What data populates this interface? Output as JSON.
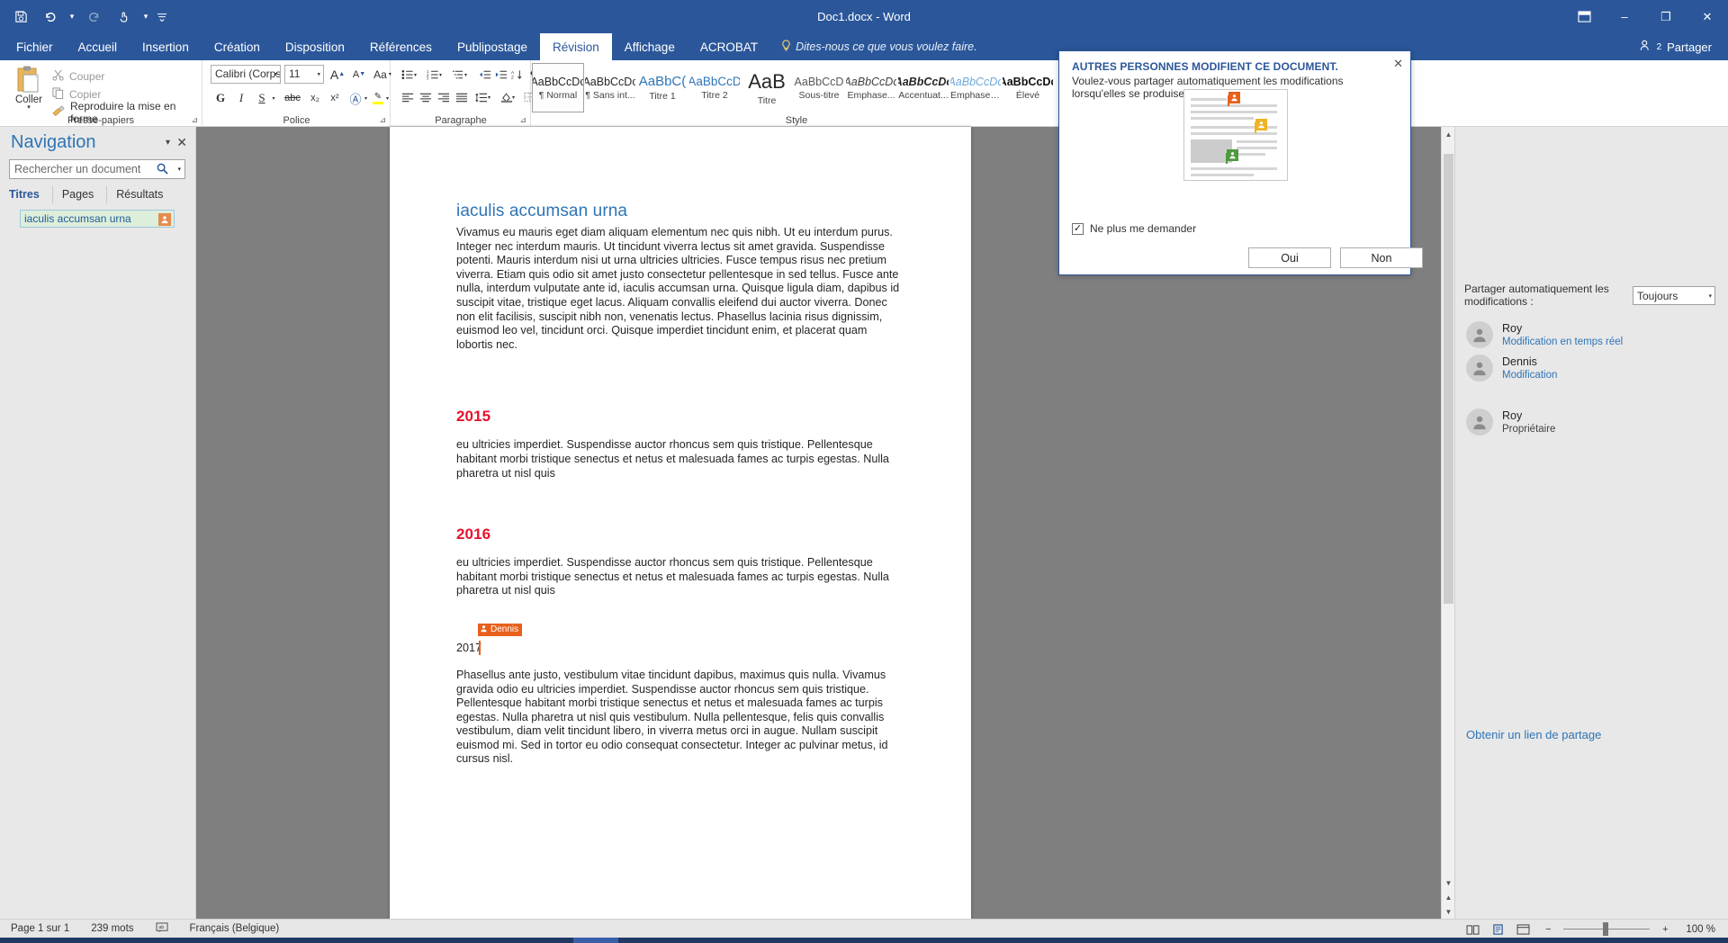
{
  "titlebar": {
    "document_title": "Doc1.docx - Word",
    "qat": [
      {
        "name": "save-icon",
        "glyph": "💾"
      },
      {
        "name": "undo-icon",
        "glyph": "↶"
      },
      {
        "name": "redo-icon",
        "glyph": "↻"
      },
      {
        "name": "touch-mode-icon",
        "glyph": "☝"
      },
      {
        "name": "customize-qat-icon",
        "glyph": "≡"
      }
    ],
    "ribbon_display_options": "⬜",
    "minimize": "–",
    "restore": "❐",
    "close": "✕"
  },
  "tabs": [
    {
      "label": "Fichier",
      "active": false
    },
    {
      "label": "Accueil",
      "active": false
    },
    {
      "label": "Insertion",
      "active": false
    },
    {
      "label": "Création",
      "active": false
    },
    {
      "label": "Disposition",
      "active": false
    },
    {
      "label": "Références",
      "active": false
    },
    {
      "label": "Publipostage",
      "active": false
    },
    {
      "label": "Révision",
      "active": true
    },
    {
      "label": "Affichage",
      "active": false
    },
    {
      "label": "ACROBAT",
      "active": false
    }
  ],
  "tellme": {
    "icon": "lightbulb-icon",
    "text": "Dites-nous ce que vous voulez faire."
  },
  "share": {
    "icon": "person-share-icon",
    "count": "2",
    "label": "Partager"
  },
  "ribbon": {
    "clipboard": {
      "group_label": "Presse-papiers",
      "paste_label": "Coller",
      "items": [
        {
          "label": "Couper",
          "icon": "scissors-icon",
          "enabled": false
        },
        {
          "label": "Copier",
          "icon": "copy-icon",
          "enabled": false
        },
        {
          "label": "Reproduire la mise en forme",
          "icon": "format-painter-icon",
          "enabled": true
        }
      ]
    },
    "font": {
      "group_label": "Police",
      "font_name": "Calibri (Corps",
      "font_size": "11",
      "buttons_row1": [
        {
          "name": "grow-font-icon",
          "glyph": "A"
        },
        {
          "name": "shrink-font-icon",
          "glyph": "A"
        },
        {
          "name": "change-case-icon",
          "glyph": "Aa"
        },
        {
          "name": "clear-formatting-icon",
          "glyph": "⬚"
        }
      ],
      "buttons_row2": [
        {
          "name": "bold-icon",
          "glyph": "G"
        },
        {
          "name": "italic-icon",
          "glyph": "I"
        },
        {
          "name": "underline-icon",
          "glyph": "S"
        },
        {
          "name": "strikethrough-icon",
          "glyph": "abc"
        },
        {
          "name": "subscript-icon",
          "glyph": "x₂"
        },
        {
          "name": "superscript-icon",
          "glyph": "x²"
        },
        {
          "name": "text-effects-icon",
          "glyph": "A"
        },
        {
          "name": "text-highlight-icon",
          "glyph": "✎"
        },
        {
          "name": "font-color-icon",
          "glyph": "A"
        }
      ]
    },
    "paragraph": {
      "group_label": "Paragraphe",
      "buttons_row1": [
        {
          "name": "bullets-icon",
          "glyph": "☰"
        },
        {
          "name": "numbering-icon",
          "glyph": "☰"
        },
        {
          "name": "multilevel-list-icon",
          "glyph": "☰"
        },
        {
          "name": "decrease-indent-icon",
          "glyph": "⇤"
        },
        {
          "name": "increase-indent-icon",
          "glyph": "⇥"
        },
        {
          "name": "sort-icon",
          "glyph": "↓"
        },
        {
          "name": "show-marks-icon",
          "glyph": "¶"
        }
      ],
      "buttons_row2": [
        {
          "name": "align-left-icon",
          "glyph": "≡"
        },
        {
          "name": "align-center-icon",
          "glyph": "≡"
        },
        {
          "name": "align-right-icon",
          "glyph": "≡"
        },
        {
          "name": "justify-icon",
          "glyph": "≡"
        },
        {
          "name": "line-spacing-icon",
          "glyph": "↕"
        },
        {
          "name": "shading-icon",
          "glyph": "▣"
        },
        {
          "name": "borders-icon",
          "glyph": "▦"
        }
      ]
    },
    "style": {
      "group_label": "Style",
      "items": [
        {
          "preview": "AaBbCcDc",
          "name": "¶ Normal",
          "selected": true,
          "color": "#262626",
          "italic": false,
          "bold": false,
          "size": 12.5
        },
        {
          "preview": "AaBbCcDc",
          "name": "¶ Sans int...",
          "selected": false,
          "color": "#262626",
          "italic": false,
          "bold": false,
          "size": 12.5
        },
        {
          "preview": "AaBbC(",
          "name": "Titre 1",
          "selected": false,
          "color": "#2e75b6",
          "italic": false,
          "bold": false,
          "size": 15
        },
        {
          "preview": "AaBbCcD",
          "name": "Titre 2",
          "selected": false,
          "color": "#2e75b6",
          "italic": false,
          "bold": false,
          "size": 13.5
        },
        {
          "preview": "AaB",
          "name": "Titre",
          "selected": false,
          "color": "#262626",
          "italic": false,
          "bold": false,
          "size": 22
        },
        {
          "preview": "AaBbCcD",
          "name": "Sous-titre",
          "selected": false,
          "color": "#595959",
          "italic": false,
          "bold": false,
          "size": 12.5
        },
        {
          "preview": "AaBbCcDc",
          "name": "Emphase...",
          "selected": false,
          "color": "#404040",
          "italic": true,
          "bold": false,
          "size": 12.5
        },
        {
          "preview": "AaBbCcDc",
          "name": "Accentuat...",
          "selected": false,
          "color": "#262626",
          "italic": true,
          "bold": true,
          "size": 12.5
        },
        {
          "preview": "AaBbCcDc",
          "name": "Emphase i...",
          "selected": false,
          "color": "#6fa8dc",
          "italic": true,
          "bold": false,
          "size": 12.5
        },
        {
          "preview": "AaBbCcDc",
          "name": "Élevé",
          "selected": false,
          "color": "#111111",
          "italic": false,
          "bold": true,
          "size": 12.5
        }
      ]
    }
  },
  "navigation": {
    "title": "Navigation",
    "collapse_icon": "chevron-down-icon",
    "close_icon": "close-icon",
    "search_placeholder": "Rechercher un document",
    "search_value": "",
    "search_icon": "search-icon",
    "tabs": [
      {
        "label": "Titres",
        "active": true
      },
      {
        "label": "Pages",
        "active": false
      },
      {
        "label": "Résultats",
        "active": false
      }
    ],
    "headings": [
      {
        "label": "iaculis accumsan urna",
        "badge_icon": "person-editing-icon"
      }
    ]
  },
  "document": {
    "heading1": "iaculis accumsan urna",
    "paragraph1": "Vivamus eu mauris eget diam aliquam elementum nec quis nibh. Ut eu interdum purus. Integer nec interdum mauris. Ut tincidunt viverra lectus sit amet gravida. Suspendisse potenti. Mauris interdum nisi ut urna ultricies ultricies. Fusce tempus risus nec pretium viverra. Etiam quis odio sit amet justo consectetur pellentesque in sed tellus. Fusce ante nulla, interdum vulputate ante id, iaculis accumsan urna. Quisque ligula diam, dapibus id suscipit vitae, tristique eget lacus. Aliquam convallis eleifend dui auctor viverra. Donec non elit facilisis, suscipit nibh non, venenatis lectus. Phasellus lacinia risus dignissim, euismod leo vel, tincidunt orci. Quisque imperdiet tincidunt enim, et placerat quam lobortis nec.",
    "heading_2015": "2015",
    "paragraph_2015": "eu ultricies imperdiet. Suspendisse auctor rhoncus sem quis tristique. Pellentesque habitant morbi tristique senectus et netus et malesuada fames ac turpis egestas. Nulla pharetra ut nisl quis",
    "heading_2016": "2016",
    "paragraph_2016": "eu ultricies imperdiet. Suspendisse auctor rhoncus sem quis tristique. Pellentesque habitant morbi tristique senectus et netus et malesuada fames ac turpis egestas. Nulla pharetra ut nisl quis",
    "year_2017": "2017",
    "coauthor_flag": {
      "name": "Dennis",
      "icon": "person-icon",
      "color": "#e8601c"
    },
    "paragraph_2017": "Phasellus ante justo, vestibulum vitae tincidunt dapibus, maximus quis nulla. Vivamus gravida odio eu ultricies imperdiet. Suspendisse auctor rhoncus sem quis tristique. Pellentesque habitant morbi tristique senectus et netus et malesuada fames ac turpis egestas. Nulla pharetra ut nisl quis vestibulum. Nulla pellentesque, felis quis convallis vestibulum, diam velit tincidunt libero, in viverra metus orci in augue. Nullam suscipit euismod mi. Sed in tortor eu odio consequat consectetur. Integer ac pulvinar metus, id cursus nisl."
  },
  "collab_dialog": {
    "title": "AUTRES PERSONNES MODIFIENT CE DOCUMENT.",
    "message": "Voulez-vous partager automatiquement les modifications lorsqu'elles se produisent ?",
    "close_icon": "close-icon",
    "checkbox_label": "Ne plus me demander",
    "checkbox_checked": true,
    "yes_label": "Oui",
    "no_label": "Non",
    "illustration_flags": [
      {
        "color": "#e8601c",
        "icon": "person-icon"
      },
      {
        "color": "#f0b323",
        "icon": "person-icon"
      },
      {
        "color": "#4e9a3e",
        "icon": "person-icon"
      }
    ]
  },
  "share_panel": {
    "autoshare_label": "Partager automatiquement les modifications :",
    "autoshare_value": "Toujours",
    "people": [
      {
        "name": "Roy",
        "status": "Modification en temps réel",
        "status_type": "link",
        "avatar_icon": "person-icon"
      },
      {
        "name": "Dennis",
        "status": "Modification",
        "status_type": "link",
        "avatar_icon": "person-icon"
      },
      {
        "name": "Roy",
        "status": "Propriétaire",
        "status_type": "plain",
        "avatar_icon": "person-icon"
      }
    ],
    "get_link_label": "Obtenir un lien de partage"
  },
  "statusbar": {
    "page": "Page 1 sur 1",
    "words": "239 mots",
    "proofing_icon": "proofing-icon",
    "language": "Français (Belgique)",
    "view_buttons": [
      {
        "name": "read-mode-icon",
        "glyph": "▤"
      },
      {
        "name": "print-layout-icon",
        "glyph": "▥"
      },
      {
        "name": "web-layout-icon",
        "glyph": "▦"
      }
    ],
    "zoom_out": "−",
    "zoom_in": "+",
    "zoom_level": "100 %"
  }
}
